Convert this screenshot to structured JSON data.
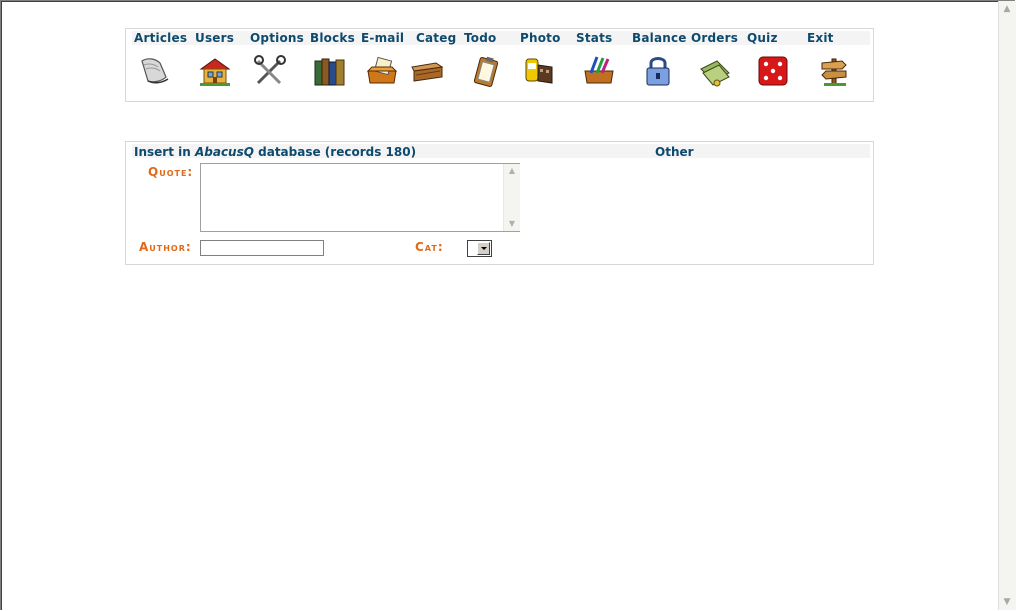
{
  "menu": {
    "items": [
      {
        "label": "Articles",
        "icon": "newspaper-icon"
      },
      {
        "label": "Users",
        "icon": "house-icon"
      },
      {
        "label": "Options",
        "icon": "tools-icon"
      },
      {
        "label": "Blocks",
        "icon": "books-icon"
      },
      {
        "label": "E-mail",
        "icon": "mail-tray-icon"
      },
      {
        "label": "Categ",
        "icon": "tray-icon"
      },
      {
        "label": "Todo",
        "icon": "clipboard-icon"
      },
      {
        "label": "Photo",
        "icon": "film-icon"
      },
      {
        "label": "Stats",
        "icon": "pencil-box-icon"
      },
      {
        "label": "Balance",
        "icon": "lock-icon"
      },
      {
        "label": "Orders",
        "icon": "money-icon"
      },
      {
        "label": "Quiz",
        "icon": "dice-icon"
      },
      {
        "label": "Exit",
        "icon": "signpost-icon"
      }
    ]
  },
  "insert": {
    "prefix": "Insert in ",
    "db_name": "AbacusQ",
    "suffix": " database (records 180)",
    "other": "Other",
    "quote_label": "Quote:",
    "quote_value": "",
    "author_label": "Author:",
    "author_value": "",
    "cat_label": "Cat:",
    "cat_value": ""
  },
  "colors": {
    "link": "#0d4a6e",
    "label_accent": "#e06a1a"
  }
}
